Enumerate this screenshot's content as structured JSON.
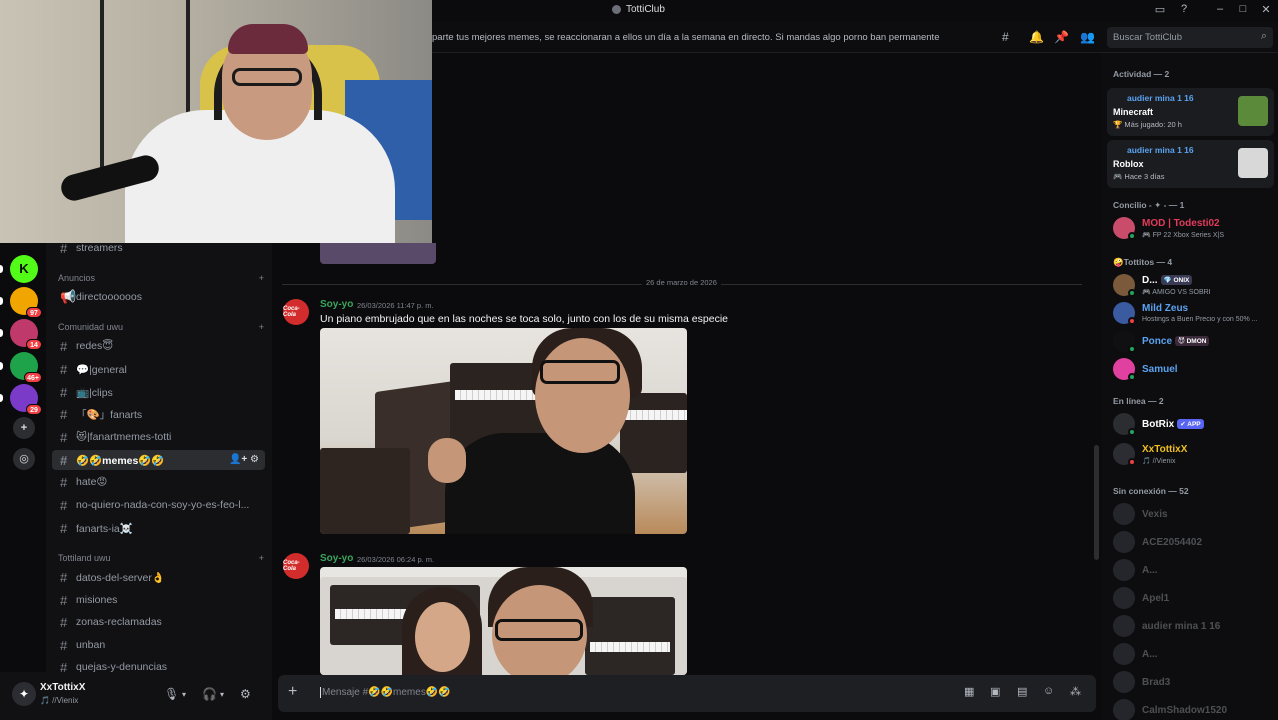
{
  "window": {
    "title": "TottiClub",
    "controls": [
      "▭",
      "?",
      "–",
      "□",
      "✕"
    ]
  },
  "rail": {
    "servers": [
      {
        "color": "#1b1b1b",
        "badge": "",
        "glyph": ""
      },
      {
        "color": "#53fc18",
        "badge": "",
        "glyph": "K"
      },
      {
        "color": "#f0a500",
        "badge": "97",
        "glyph": ""
      },
      {
        "color": "#c0396b",
        "badge": "14",
        "glyph": ""
      },
      {
        "color": "#1fa34a",
        "badge": "46+",
        "glyph": ""
      },
      {
        "color": "#7a3cc8",
        "badge": "29",
        "glyph": ""
      },
      {
        "color": "#2b2d31",
        "badge": "",
        "glyph": "+"
      },
      {
        "color": "#2b2d31",
        "badge": "",
        "glyph": "◎"
      }
    ]
  },
  "channels": {
    "partial_top": "streamers",
    "categories": [
      {
        "name": "Anuncios",
        "items": [
          "directoooooos"
        ]
      },
      {
        "name": "Comunidad uwu",
        "items": [
          "redes😇",
          "💬|general",
          "📺|clips",
          "「🎨」fanarts",
          "😻|fanartmemes-totti",
          "🤣🤣memes🤣🤣",
          "hate😡",
          "no-quiero-nada-con-soy-yo-es-feo-l...",
          "fanarts-ia☠️"
        ]
      },
      {
        "name": "Tottiland uwu",
        "items": [
          "datos-del-server👌",
          "misiones",
          "zonas-reclamadas",
          "unban",
          "quejas-y-denuncias"
        ]
      }
    ],
    "active": "🤣🤣memes🤣🤣"
  },
  "header": {
    "topic": "parte tus mejores memes, se reaccionaran a ellos un día a la semana en directo. Si mandas algo porno ban permanente",
    "search_placeholder": "Buscar TottiClub"
  },
  "chat": {
    "date_divider": "26 de marzo de 2026",
    "messages": [
      {
        "author": "Soy-yo",
        "time": "26/03/2026 11:47 p. m.",
        "text": "Un piano embrujado que en las noches se toca solo, junto con los de su misma especie",
        "avatar": "Coca-Cola"
      },
      {
        "author": "Soy-yo",
        "time": "26/03/2026 06:24 p. m.",
        "text": "",
        "avatar": "Coca-Cola"
      }
    ],
    "composer_placeholder": "Mensaje #🤣🤣memes🤣🤣"
  },
  "user": {
    "name": "XxTottixX",
    "status": "🎵 //Vienix"
  },
  "members": {
    "activity_header": "Actividad — 2",
    "activities": [
      {
        "who": "audier mina 1 16",
        "game": "Minecraft",
        "since": "🏆 Más jugado: 20 h",
        "art_color": "#5a8a3a"
      },
      {
        "who": "audier mina 1 16",
        "game": "Roblox",
        "since": "🎮 Hace 3 días",
        "art_color": "#d8d8d8"
      }
    ],
    "groups": [
      {
        "header": "Concilio - ✦ - — 1",
        "items": [
          {
            "name": "MOD | Todesti02",
            "sub": "🎮 FP 22 Xbox Series X|S",
            "color": "#e23b5b",
            "av": "#c94d6a",
            "status": "#23a55a",
            "tag": "",
            "tagc": ""
          }
        ]
      },
      {
        "header": "🤪Tottitos — 4",
        "items": [
          {
            "name": "D...",
            "sub": "🎮 AMIGO VS SOBRI",
            "color": "#ffffff",
            "av": "#7a5a3a",
            "status": "#23a55a",
            "tag": "💎 ONIX",
            "tagc": "#3a3a55"
          },
          {
            "name": "Mild Zeus",
            "sub": "Hostings a Buen Precio y con 50% ...",
            "color": "#5ba3f0",
            "av": "#3a5ba0",
            "status": "#f23f43",
            "tag": "",
            "tagc": ""
          },
          {
            "name": "Ponce",
            "sub": "",
            "color": "#5ba3f0",
            "av": "#101012",
            "status": "#23a55a",
            "tag": "😈 DMON",
            "tagc": "#3a2a3a"
          },
          {
            "name": "Samuel",
            "sub": "",
            "color": "#5ba3f0",
            "av": "#e040a0",
            "status": "#23a55a",
            "tag": "",
            "tagc": ""
          }
        ]
      },
      {
        "header": "En línea — 2",
        "items": [
          {
            "name": "BotRix",
            "sub": "",
            "color": "#ffffff",
            "av": "#2b2d31",
            "status": "#23a55a",
            "tag": "✔ APP",
            "tagc": "#5865f2"
          },
          {
            "name": "XxTottixX",
            "sub": "🎵 //Vienix",
            "color": "#f0c020",
            "av": "#2c2c33",
            "status": "#f23f43",
            "tag": "",
            "tagc": ""
          }
        ]
      }
    ],
    "offline_header": "Sin conexión — 52",
    "offline": [
      "Vexis",
      "ACE2054402",
      "A...",
      "Apel1",
      "audier mina 1 16",
      "A...",
      "Brad3",
      "CalmShadow1520"
    ]
  }
}
